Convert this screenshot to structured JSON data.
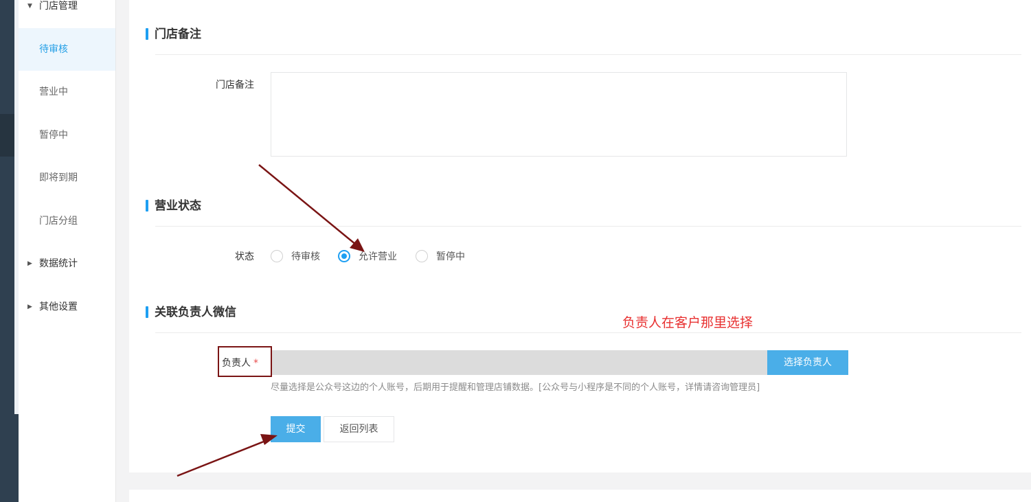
{
  "sidebar": {
    "group_store": "门店管理",
    "items": [
      "待审核",
      "营业中",
      "暂停中",
      "即将到期",
      "门店分组"
    ],
    "group_stats": "数据统计",
    "group_other": "其他设置"
  },
  "remark": {
    "section_title": "门店备注",
    "label": "门店备注",
    "value": ""
  },
  "status": {
    "section_title": "营业状态",
    "label": "状态",
    "options": [
      "待审核",
      "允许营业",
      "暂停中"
    ],
    "selected": "允许营业"
  },
  "owner": {
    "section_title": "关联负责人微信",
    "label": "负责人",
    "required_mark": "*",
    "value": "",
    "select_button": "选择负责人",
    "hint": "尽量选择是公众号这边的个人账号，后期用于提醒和管理店铺数据。[公众号与小程序是不同的个人账号，详情请咨询管理员]",
    "annotation": "负责人在客户那里选择"
  },
  "actions": {
    "submit": "提交",
    "back": "返回列表"
  },
  "colors": {
    "accent": "#1e9ff2",
    "button": "#4aaee8",
    "annotation_red": "#e83030",
    "arrow": "#7a1414"
  }
}
